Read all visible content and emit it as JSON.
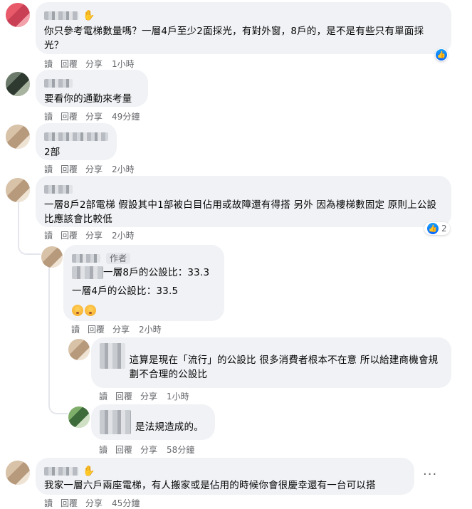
{
  "actions": {
    "reply_label": "回覆",
    "share_label": "分享",
    "read_label": "讀"
  },
  "comments": [
    {
      "text": "你只參考電梯數量嗎？一層4戶至少2面採光，有對外窗，8戶的，是不是有些只有單面採光？",
      "time": "1小時"
    },
    {
      "text": "要看你的通勤來考量",
      "time": "49分鐘"
    },
    {
      "text": "2部",
      "time": "2小時"
    },
    {
      "text": "一層8戶2部電梯 假設其中1部被白目佔用或故障還有得搭 另外 因為樓梯數固定 原則上公設比應該會比較低",
      "time": "2小時",
      "reaction_count": "2"
    },
    {
      "author_tag": "作者",
      "line1": "一層8戶的公設比：33.3",
      "line2": "一層4戶的公設比：33.5",
      "time": "2小時"
    },
    {
      "text": "這算是現在「流行」的公設比 很多消費者根本不在意 所以給建商機會規劃不合理的公設比",
      "time": "1小時"
    },
    {
      "text": "是法規造成的。",
      "time": "58分鐘"
    },
    {
      "text": "我家一層六戶兩座電梯，有人搬家或是佔用的時候你會很慶幸還有一台可以搭",
      "time": "45分鐘"
    }
  ],
  "more_label": "···"
}
